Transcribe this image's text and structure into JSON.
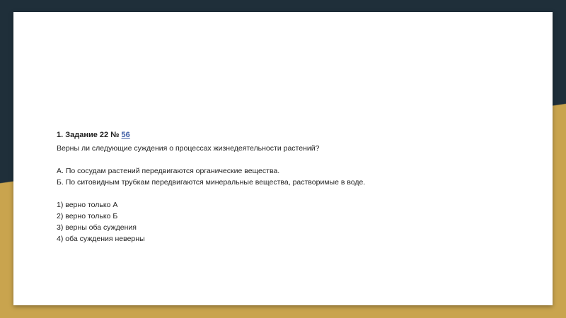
{
  "task": {
    "title_prefix": "1. Задание 22 №",
    "number_link": "56",
    "question": "Верны ли следующие суждения о процессах жизнедеятельности растений?",
    "statements": [
      "А. По сосудам растений передвигаются органические вещества.",
      "Б. По ситовидным трубкам передвигаются минеральные вещества, растворимые в воде."
    ],
    "options": [
      "1) верно только А",
      "2) верно только Б",
      "3) верны оба суждения",
      "4) оба суждения неверны"
    ]
  },
  "colors": {
    "background_top": "#1f2f3a",
    "background_bottom": "#c9a44e",
    "link": "#3b5aa3"
  }
}
